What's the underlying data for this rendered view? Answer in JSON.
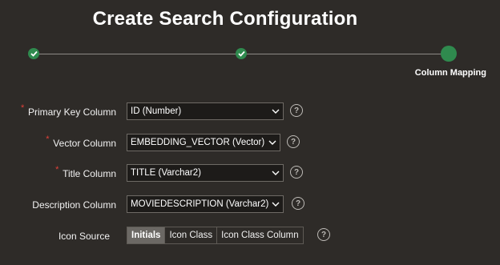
{
  "dialog": {
    "title": "Create Search Configuration"
  },
  "wizard": {
    "steps": [
      {
        "state": "complete",
        "icon": "check-icon"
      },
      {
        "state": "complete",
        "icon": "check-icon"
      },
      {
        "state": "current",
        "label": "Column Mapping"
      }
    ],
    "current_label": "Column Mapping",
    "colors": {
      "step": "#2f8a4e",
      "line": "#8d8a86"
    }
  },
  "form": {
    "primary_key": {
      "label": "Primary Key Column",
      "value": "ID (Number)",
      "required": true
    },
    "vector": {
      "label": "Vector Column",
      "value": "EMBEDDING_VECTOR (Vector)",
      "required": true
    },
    "title_col": {
      "label": "Title Column",
      "value": "TITLE (Varchar2)",
      "required": true
    },
    "description": {
      "label": "Description Column",
      "value": "MOVIEDESCRIPTION (Varchar2)",
      "required": false
    },
    "icon_source": {
      "label": "Icon Source",
      "options": [
        "Initials",
        "Icon Class",
        "Icon Class Column"
      ],
      "selected": "Initials"
    },
    "help_glyph": "?",
    "required_glyph": "*"
  },
  "colors": {
    "background": "#2e2b28",
    "field_bg": "#1d1b19",
    "required": "#e0413a",
    "selected_segment": "#6b6864"
  }
}
